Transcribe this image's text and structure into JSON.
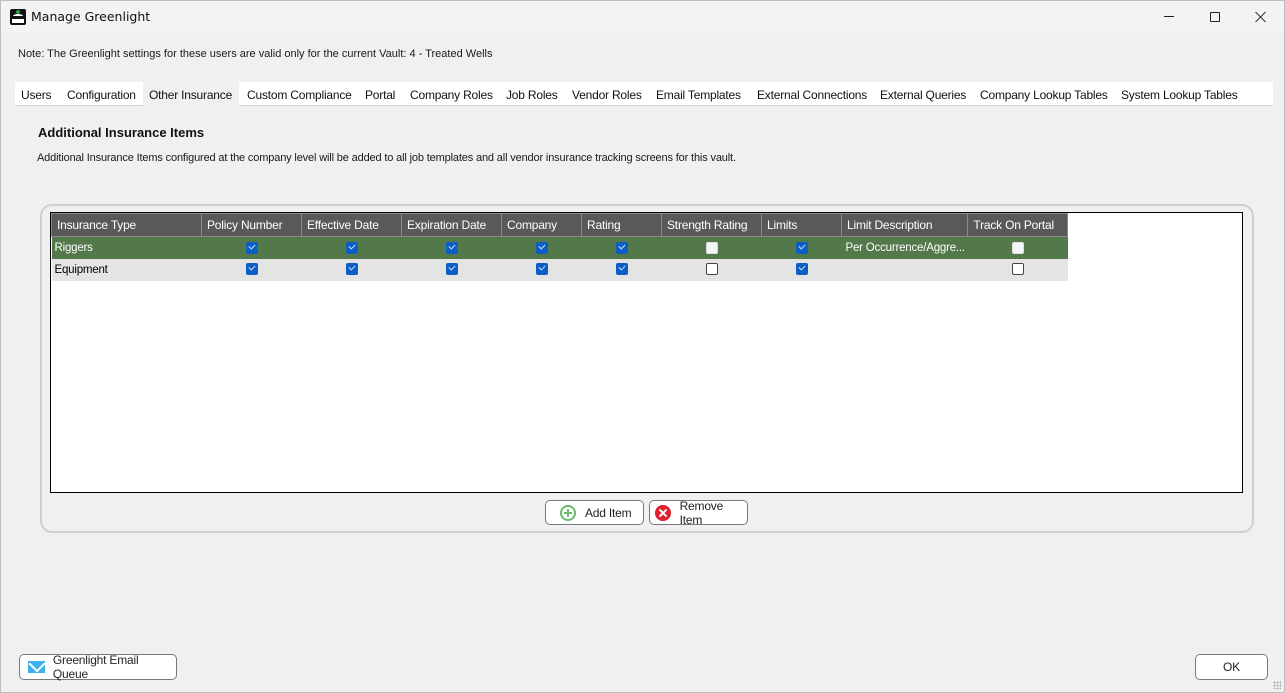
{
  "window": {
    "title": "Manage Greenlight",
    "controls": {
      "minimize": "minimize",
      "maximize": "maximize",
      "close": "close"
    }
  },
  "note": "Note:  The Greenlight settings for these users are valid only for the current Vault: 4 - Treated Wells",
  "tabs": [
    {
      "label": "Users",
      "active": false
    },
    {
      "label": "Configuration",
      "active": false
    },
    {
      "label": "Other Insurance",
      "active": true
    },
    {
      "label": "Custom Compliance",
      "active": false
    },
    {
      "label": "Portal",
      "active": false
    },
    {
      "label": "Company Roles",
      "active": false
    },
    {
      "label": "Job Roles",
      "active": false
    },
    {
      "label": "Vendor Roles",
      "active": false
    },
    {
      "label": "Email Templates",
      "active": false
    },
    {
      "label": "External Connections",
      "active": false
    },
    {
      "label": "External Queries",
      "active": false
    },
    {
      "label": "Company Lookup Tables",
      "active": false
    },
    {
      "label": "System Lookup Tables",
      "active": false
    }
  ],
  "section": {
    "title": "Additional Insurance Items",
    "description": "Additional Insurance Items configured at the company level will be added to all job templates and all vendor insurance tracking screens for this vault."
  },
  "grid": {
    "columns": [
      "Insurance Type",
      "Policy Number",
      "Effective Date",
      "Expiration Date",
      "Company",
      "Rating",
      "Strength Rating",
      "Limits",
      "Limit Description",
      "Track On Portal"
    ],
    "rows": [
      {
        "insurance_type": "Riggers",
        "policy_number": true,
        "effective_date": true,
        "expiration_date": true,
        "company": true,
        "rating": true,
        "strength_rating": false,
        "limits": true,
        "limit_description": "Per Occurrence/Aggre...",
        "track_on_portal": false,
        "selected": true
      },
      {
        "insurance_type": "Equipment",
        "policy_number": true,
        "effective_date": true,
        "expiration_date": true,
        "company": true,
        "rating": true,
        "strength_rating": false,
        "limits": true,
        "limit_description": "",
        "track_on_portal": false,
        "selected": false
      }
    ]
  },
  "buttons": {
    "add_item": "Add Item",
    "remove_item": "Remove Item",
    "email_queue": "Greenlight Email Queue",
    "ok": "OK"
  },
  "colors": {
    "selected_row": "#53784a",
    "header": "#595959",
    "checkbox_checked": "#0b5fc4",
    "add_icon": "#6fb96f",
    "remove_icon": "#e0202e",
    "mail_icon": "#3fb1ea"
  }
}
